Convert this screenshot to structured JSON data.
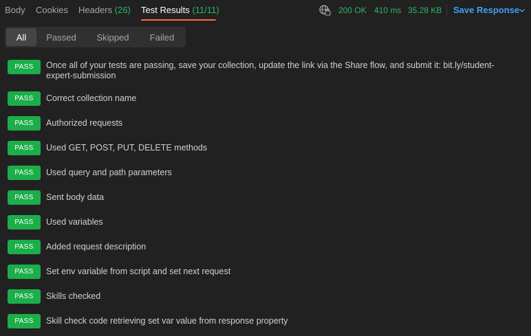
{
  "tabs": {
    "body": "Body",
    "cookies": "Cookies",
    "headers": "Headers",
    "headers_count": "(26)",
    "test_results": "Test Results",
    "test_results_count": "(11/11)"
  },
  "response_meta": {
    "status": "200 OK",
    "time": "410 ms",
    "size": "35.28 KB",
    "save_response": "Save Response",
    "globe_icon": "globe-icon",
    "chevron_icon": "chevron-down-icon"
  },
  "filters": {
    "all": "All",
    "passed": "Passed",
    "skipped": "Skipped",
    "failed": "Failed"
  },
  "results": [
    {
      "status": "PASS",
      "text": "Once all of your tests are passing, save your collection, update the link via the Share flow, and submit it: bit.ly/student-expert-submission"
    },
    {
      "status": "PASS",
      "text": "Correct collection name"
    },
    {
      "status": "PASS",
      "text": "Authorized requests"
    },
    {
      "status": "PASS",
      "text": "Used GET, POST, PUT, DELETE methods"
    },
    {
      "status": "PASS",
      "text": "Used query and path parameters"
    },
    {
      "status": "PASS",
      "text": "Sent body data"
    },
    {
      "status": "PASS",
      "text": "Used variables"
    },
    {
      "status": "PASS",
      "text": "Added request description"
    },
    {
      "status": "PASS",
      "text": "Set env variable from script and set next request"
    },
    {
      "status": "PASS",
      "text": "Skills checked"
    },
    {
      "status": "PASS",
      "text": "Skill check code retrieving set var value from response property"
    }
  ],
  "colors": {
    "background": "#212121",
    "pass_badge": "#1cae4a",
    "accent_orange": "#ff6c37",
    "status_green": "#2fb862",
    "link_blue": "#3f9ff5"
  }
}
